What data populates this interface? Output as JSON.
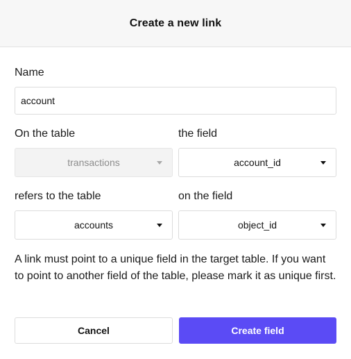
{
  "dialog": {
    "title": "Create a new link"
  },
  "form": {
    "name_label": "Name",
    "name_value": "account",
    "on_table_label": "On the table",
    "on_table_value": "transactions",
    "the_field_label": "the field",
    "the_field_value": "account_id",
    "refers_to_label": "refers to the table",
    "refers_to_value": "accounts",
    "on_field_label": "on the field",
    "on_field_value": "object_id"
  },
  "help_text": "A link must point to a unique field in the target table. If you want to point to another field of the table, please mark it as unique first.",
  "buttons": {
    "cancel_label": "Cancel",
    "create_label": "Create field"
  },
  "colors": {
    "primary": "#5b4bf5",
    "header_bg": "#f7f7f7",
    "disabled_bg": "#f3f3f3"
  },
  "icons": {
    "dropdown": "caret-down-icon"
  }
}
